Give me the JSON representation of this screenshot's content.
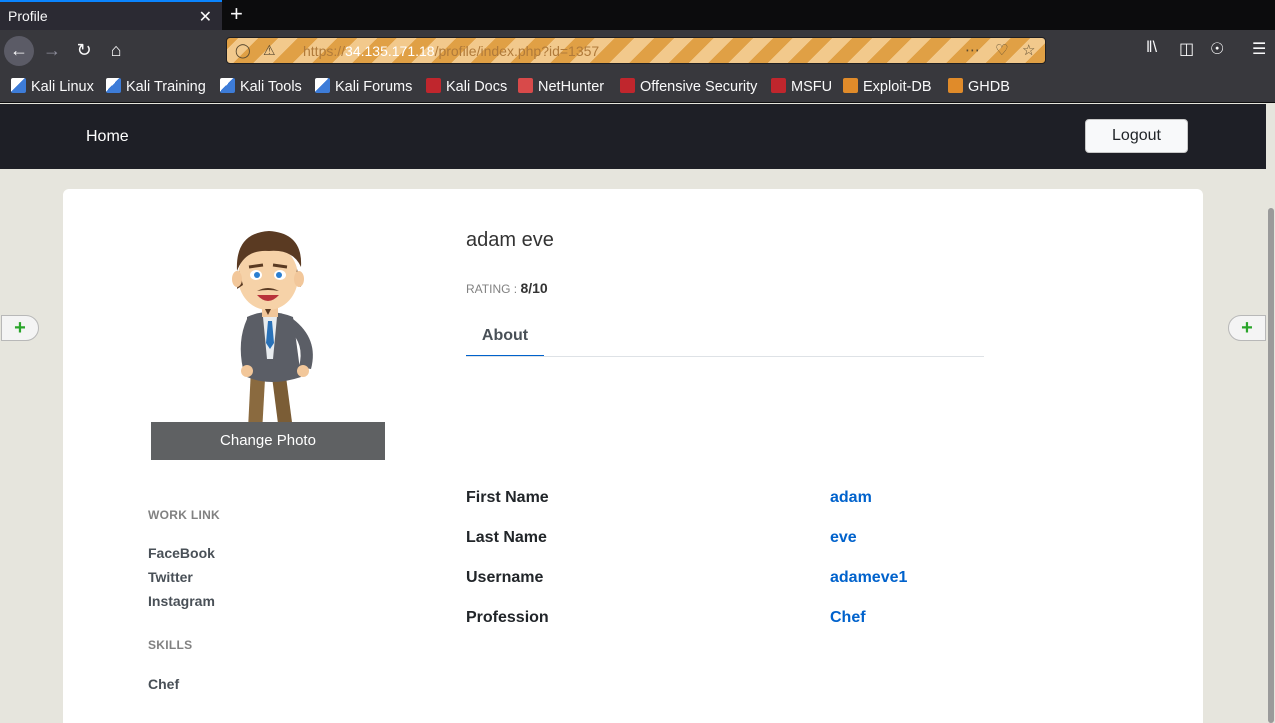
{
  "browser": {
    "tab_title": "Profile",
    "tab_close": "✕",
    "new_tab": "+",
    "url_prefix": "https://",
    "url_host": "34.135.171.18",
    "url_path": "/profile/index.php?id=1357",
    "bookmarks": [
      "Kali Linux",
      "Kali Training",
      "Kali Tools",
      "Kali Forums",
      "Kali Docs",
      "NetHunter",
      "Offensive Security",
      "MSFU",
      "Exploit-DB",
      "GHDB"
    ]
  },
  "nav": {
    "home": "Home",
    "logout": "Logout"
  },
  "profile": {
    "name": "adam eve",
    "rating_label": "RATING : ",
    "rating_value": "8/10",
    "change_photo": "Change Photo",
    "tab_about": "About"
  },
  "sidebar": {
    "work_link_heading": "WORK LINK",
    "links": [
      "FaceBook",
      "Twitter",
      "Instagram"
    ],
    "skills_heading": "SKILLS",
    "skills": [
      "Chef"
    ]
  },
  "about": {
    "rows": [
      {
        "label": "First Name",
        "value": "adam"
      },
      {
        "label": "Last Name",
        "value": "eve"
      },
      {
        "label": "Username",
        "value": "adameve1"
      },
      {
        "label": "Profession",
        "value": "Chef"
      }
    ]
  },
  "colors": {
    "link_blue": "#0062cc",
    "nav_dark": "#1e1f26",
    "page_bg": "#e6e5dd"
  }
}
